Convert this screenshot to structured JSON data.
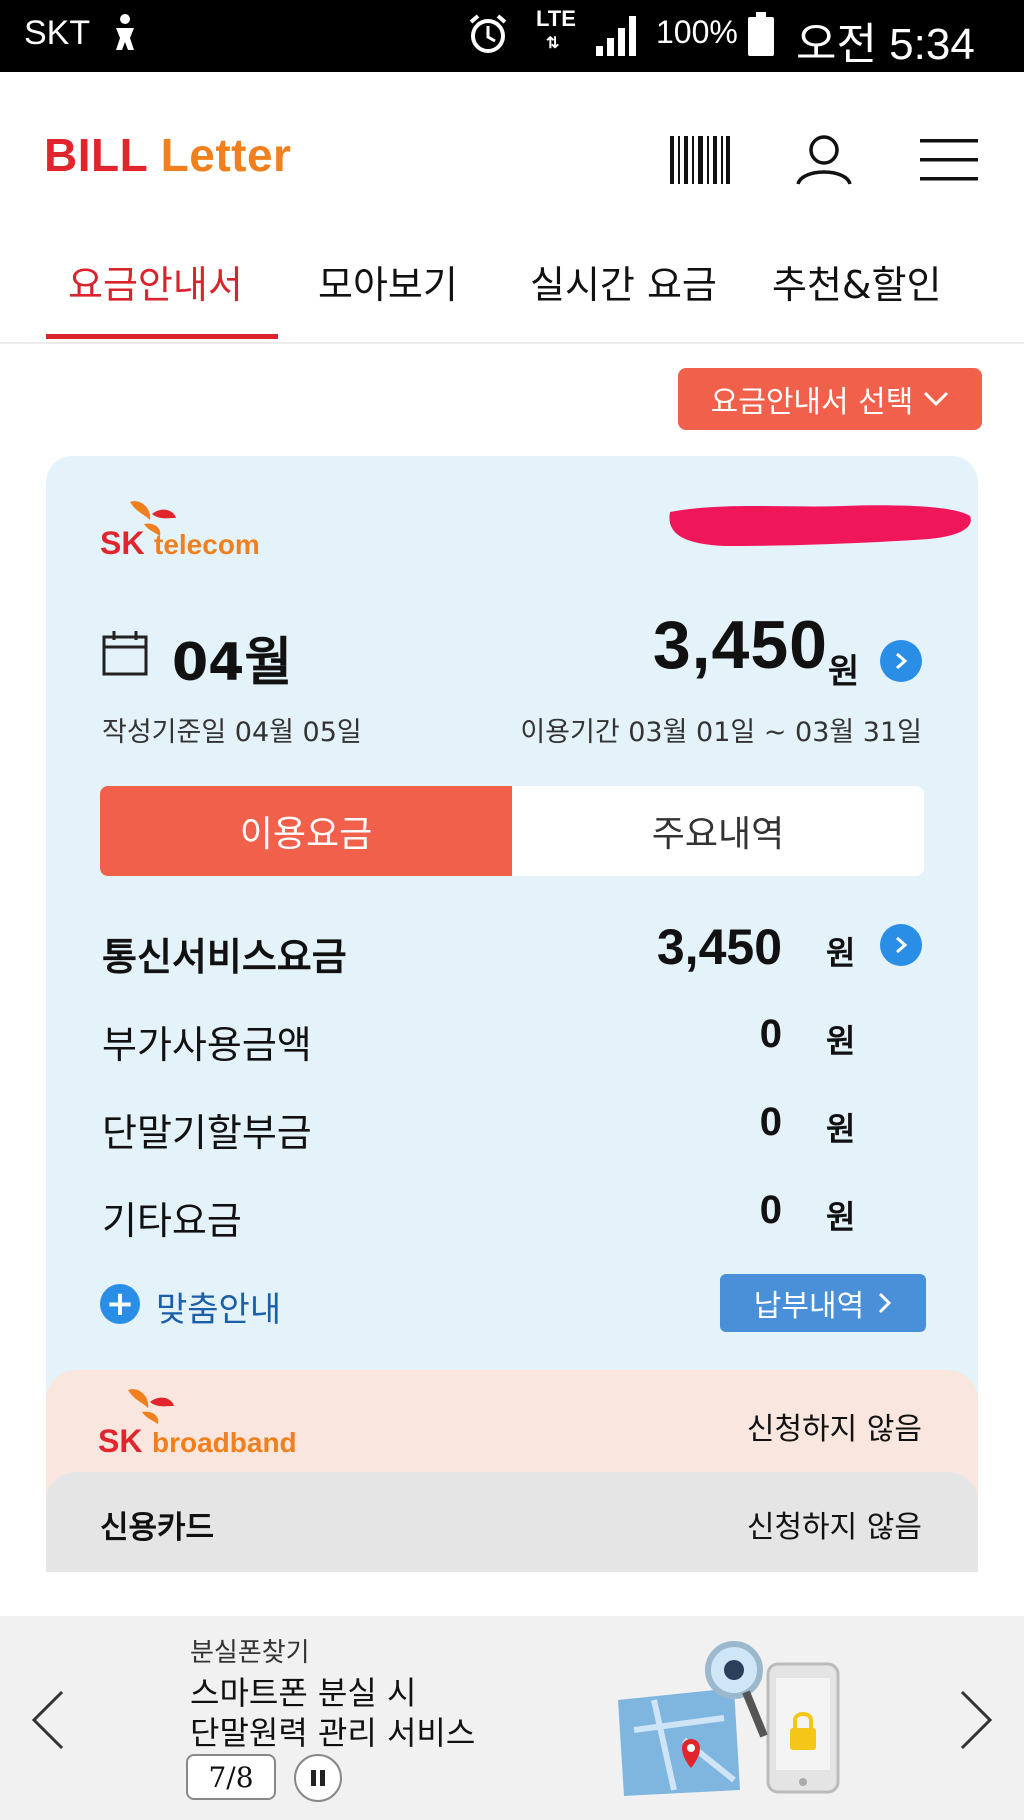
{
  "status_bar": {
    "carrier": "SKT",
    "network": "LTE",
    "battery": "100%",
    "time": "오전 5:34"
  },
  "header": {
    "logo_part1": "BILL",
    "logo_part2": "Letter"
  },
  "tabs": [
    {
      "label": "요금안내서",
      "active": true
    },
    {
      "label": "모아보기",
      "active": false
    },
    {
      "label": "실시간 요금",
      "active": false
    },
    {
      "label": "추천&할인",
      "active": false
    }
  ],
  "select_button": "요금안내서 선택",
  "telecom": {
    "brand_sk": "SK",
    "brand_name": "telecom",
    "month": "04월",
    "total_amount": "3,450",
    "currency": "원",
    "created_date": "작성기준일 04월 05일",
    "usage_period": "이용기간 03월 01일 ~ 03월 31일",
    "segments": [
      "이용요금",
      "주요내역"
    ],
    "rows": [
      {
        "label": "통신서비스요금",
        "amount": "3,450",
        "unit": "원"
      },
      {
        "label": "부가사용금액",
        "amount": "0",
        "unit": "원"
      },
      {
        "label": "단말기할부금",
        "amount": "0",
        "unit": "원"
      },
      {
        "label": "기타요금",
        "amount": "0",
        "unit": "원"
      }
    ],
    "custom_info": "맞춤안내",
    "payment_history": "납부내역"
  },
  "broadband": {
    "brand_sk": "SK",
    "brand_name": "broadband",
    "status": "신청하지 않음"
  },
  "credit_card": {
    "label": "신용카드",
    "status": "신청하지 않음"
  },
  "banner": {
    "kicker": "분실폰찾기",
    "line1": "스마트폰 분실 시",
    "line2": "단말원력 관리 서비스",
    "page": "7/8"
  },
  "colors": {
    "brand_red": "#e0262c",
    "brand_orange": "#f07f1e",
    "accent_coral": "#f0604a",
    "accent_blue": "#2a8ee6",
    "card_bg": "#e4f2fa"
  }
}
